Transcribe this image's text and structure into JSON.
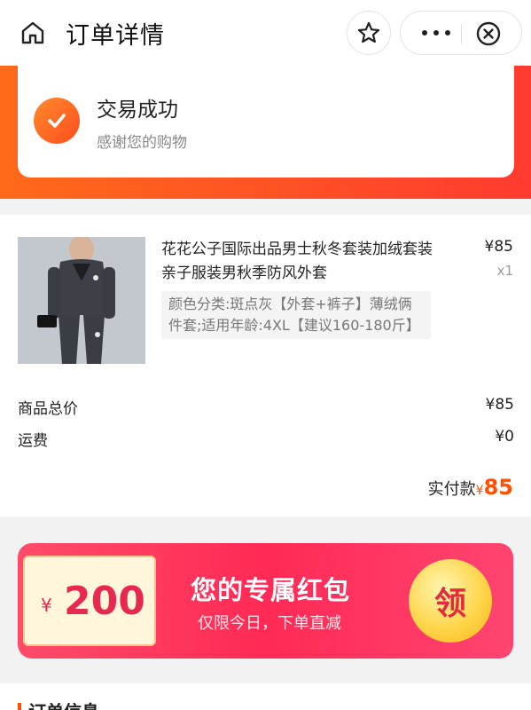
{
  "nav": {
    "title": "订单详情"
  },
  "status": {
    "title": "交易成功",
    "subtitle": "感谢您的购物"
  },
  "product": {
    "name": "花花公子国际出品男士秋冬套装加绒套装亲子服装男秋季防风外套",
    "price": "¥85",
    "qty": "x1",
    "spec": "颜色分类:斑点灰【外套+裤子】薄绒俩件套;适用年龄:4XL【建议160-180斤】"
  },
  "summary": {
    "total_label": "商品总价",
    "total_value": "¥85",
    "shipping_label": "运费",
    "shipping_value": "¥0",
    "paid_label": "实付款",
    "paid_currency": "¥",
    "paid_value": "85"
  },
  "redpacket": {
    "currency": "¥",
    "amount": "200",
    "title": "您的专属红包",
    "subtitle": "仅限今日，下单直减",
    "claim_label": "领"
  },
  "order_info": {
    "title": "订单信息"
  },
  "colors": {
    "accent": "#ff5000",
    "banner": "#ff3b2f",
    "packet": "#ff2a55"
  }
}
